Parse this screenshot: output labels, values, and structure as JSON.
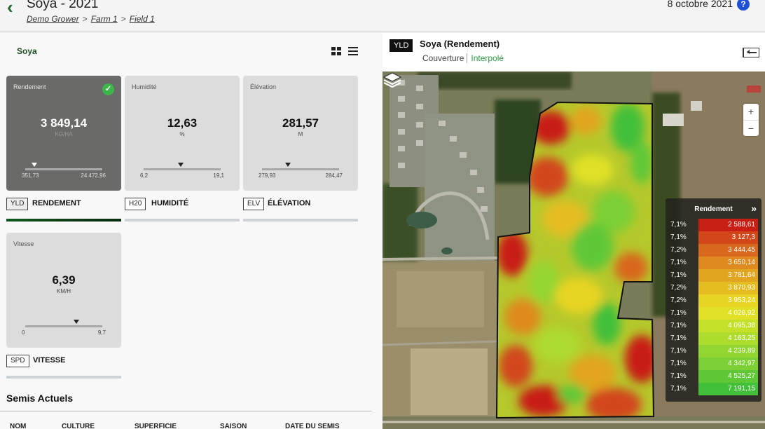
{
  "header": {
    "back_icon": "chevron-left-icon",
    "title": "Soya - 2021",
    "breadcrumb": [
      {
        "label": "Demo Grower"
      },
      {
        "label": "Farm 1"
      },
      {
        "label": "Field 1"
      }
    ],
    "separator": ">",
    "date": "8 octobre 2021",
    "help": "?"
  },
  "left": {
    "crop": "Soya",
    "view_toggle": {
      "grid_icon": "grid-icon",
      "list_icon": "list-icon"
    },
    "cards": [
      {
        "name": "Rendement",
        "value": "3 849,14",
        "unit": "KG/HA",
        "min": "351,73",
        "max": "24 472,96",
        "marker_fraction": 0.12,
        "code": "YLD",
        "label": "RENDEMENT",
        "selected": true
      },
      {
        "name": "Humidité",
        "value": "12,63",
        "unit": "%",
        "min": "6,2",
        "max": "19,1",
        "marker_fraction": 0.48,
        "code": "H20",
        "label": "HUMIDITÉ",
        "selected": false
      },
      {
        "name": "Élévation",
        "value": "281,57",
        "unit": "M",
        "min": "279,93",
        "max": "284,47",
        "marker_fraction": 0.34,
        "code": "ELV",
        "label": "ÉLÉVATION",
        "selected": false
      },
      {
        "name": "Vitesse",
        "value": "6,39",
        "unit": "KM/H",
        "min": "0",
        "max": "9,7",
        "marker_fraction": 0.66,
        "code": "SPD",
        "label": "VITESSE",
        "selected": false
      }
    ],
    "section_title": "Semis Actuels",
    "columns": [
      "NOM",
      "CULTURE",
      "SUPERFICIE",
      "SAISON",
      "DATE DU SEMIS"
    ]
  },
  "map": {
    "badge": "YLD",
    "title": "Soya (Rendement)",
    "tabs": [
      "Couverture",
      "Interpolé"
    ],
    "active_tab": "Interpolé",
    "collapse_icon": "panel-collapse-icon",
    "layers_icon": "layers-icon",
    "zoom_in": "+",
    "zoom_out": "−",
    "legend": {
      "title": "Rendement",
      "collapse": "»",
      "rows": [
        {
          "pct": "7,1%",
          "value": "2 588,61",
          "color": "#c81e14"
        },
        {
          "pct": "7,1%",
          "value": "3 127,3",
          "color": "#d2461a"
        },
        {
          "pct": "7,2%",
          "value": "3 444,45",
          "color": "#d8681c"
        },
        {
          "pct": "7,1%",
          "value": "3 650,14",
          "color": "#de8a1e"
        },
        {
          "pct": "7,1%",
          "value": "3 781,64",
          "color": "#e2a51f"
        },
        {
          "pct": "7,2%",
          "value": "3 870,93",
          "color": "#e5bd20"
        },
        {
          "pct": "7,2%",
          "value": "3 953,24",
          "color": "#e8d422"
        },
        {
          "pct": "7,1%",
          "value": "4 026,92",
          "color": "#e0e125"
        },
        {
          "pct": "7,1%",
          "value": "4 095,38",
          "color": "#c6e02a"
        },
        {
          "pct": "7,1%",
          "value": "4 163,25",
          "color": "#aedc2d"
        },
        {
          "pct": "7,1%",
          "value": "4 239,89",
          "color": "#94d631"
        },
        {
          "pct": "7,1%",
          "value": "4 342,97",
          "color": "#7ccf34"
        },
        {
          "pct": "7,1%",
          "value": "4 525,27",
          "color": "#60c837"
        },
        {
          "pct": "7,1%",
          "value": "7 191,15",
          "color": "#42c03a"
        }
      ]
    }
  }
}
